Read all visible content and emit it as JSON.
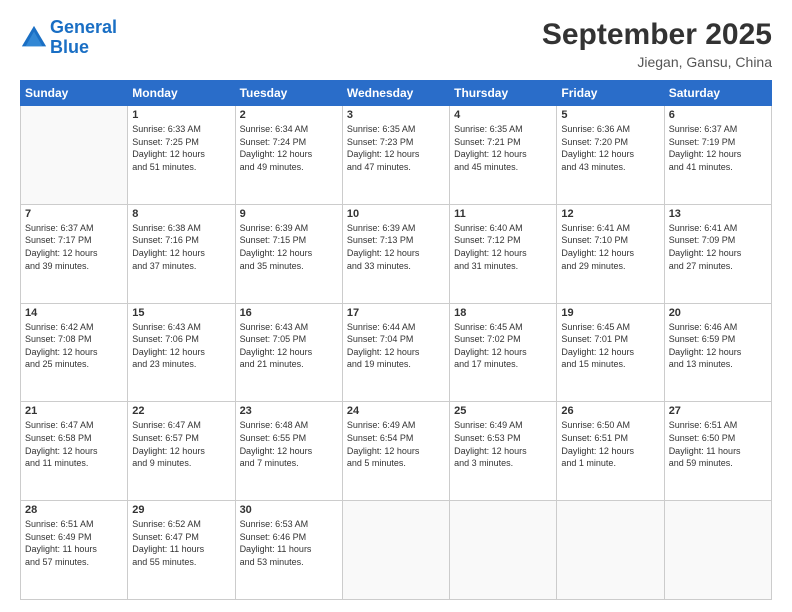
{
  "header": {
    "logo_line1": "General",
    "logo_line2": "Blue",
    "month_year": "September 2025",
    "location": "Jiegan, Gansu, China"
  },
  "days_of_week": [
    "Sunday",
    "Monday",
    "Tuesday",
    "Wednesday",
    "Thursday",
    "Friday",
    "Saturday"
  ],
  "weeks": [
    [
      {
        "day": "",
        "info": ""
      },
      {
        "day": "1",
        "info": "Sunrise: 6:33 AM\nSunset: 7:25 PM\nDaylight: 12 hours\nand 51 minutes."
      },
      {
        "day": "2",
        "info": "Sunrise: 6:34 AM\nSunset: 7:24 PM\nDaylight: 12 hours\nand 49 minutes."
      },
      {
        "day": "3",
        "info": "Sunrise: 6:35 AM\nSunset: 7:23 PM\nDaylight: 12 hours\nand 47 minutes."
      },
      {
        "day": "4",
        "info": "Sunrise: 6:35 AM\nSunset: 7:21 PM\nDaylight: 12 hours\nand 45 minutes."
      },
      {
        "day": "5",
        "info": "Sunrise: 6:36 AM\nSunset: 7:20 PM\nDaylight: 12 hours\nand 43 minutes."
      },
      {
        "day": "6",
        "info": "Sunrise: 6:37 AM\nSunset: 7:19 PM\nDaylight: 12 hours\nand 41 minutes."
      }
    ],
    [
      {
        "day": "7",
        "info": "Sunrise: 6:37 AM\nSunset: 7:17 PM\nDaylight: 12 hours\nand 39 minutes."
      },
      {
        "day": "8",
        "info": "Sunrise: 6:38 AM\nSunset: 7:16 PM\nDaylight: 12 hours\nand 37 minutes."
      },
      {
        "day": "9",
        "info": "Sunrise: 6:39 AM\nSunset: 7:15 PM\nDaylight: 12 hours\nand 35 minutes."
      },
      {
        "day": "10",
        "info": "Sunrise: 6:39 AM\nSunset: 7:13 PM\nDaylight: 12 hours\nand 33 minutes."
      },
      {
        "day": "11",
        "info": "Sunrise: 6:40 AM\nSunset: 7:12 PM\nDaylight: 12 hours\nand 31 minutes."
      },
      {
        "day": "12",
        "info": "Sunrise: 6:41 AM\nSunset: 7:10 PM\nDaylight: 12 hours\nand 29 minutes."
      },
      {
        "day": "13",
        "info": "Sunrise: 6:41 AM\nSunset: 7:09 PM\nDaylight: 12 hours\nand 27 minutes."
      }
    ],
    [
      {
        "day": "14",
        "info": "Sunrise: 6:42 AM\nSunset: 7:08 PM\nDaylight: 12 hours\nand 25 minutes."
      },
      {
        "day": "15",
        "info": "Sunrise: 6:43 AM\nSunset: 7:06 PM\nDaylight: 12 hours\nand 23 minutes."
      },
      {
        "day": "16",
        "info": "Sunrise: 6:43 AM\nSunset: 7:05 PM\nDaylight: 12 hours\nand 21 minutes."
      },
      {
        "day": "17",
        "info": "Sunrise: 6:44 AM\nSunset: 7:04 PM\nDaylight: 12 hours\nand 19 minutes."
      },
      {
        "day": "18",
        "info": "Sunrise: 6:45 AM\nSunset: 7:02 PM\nDaylight: 12 hours\nand 17 minutes."
      },
      {
        "day": "19",
        "info": "Sunrise: 6:45 AM\nSunset: 7:01 PM\nDaylight: 12 hours\nand 15 minutes."
      },
      {
        "day": "20",
        "info": "Sunrise: 6:46 AM\nSunset: 6:59 PM\nDaylight: 12 hours\nand 13 minutes."
      }
    ],
    [
      {
        "day": "21",
        "info": "Sunrise: 6:47 AM\nSunset: 6:58 PM\nDaylight: 12 hours\nand 11 minutes."
      },
      {
        "day": "22",
        "info": "Sunrise: 6:47 AM\nSunset: 6:57 PM\nDaylight: 12 hours\nand 9 minutes."
      },
      {
        "day": "23",
        "info": "Sunrise: 6:48 AM\nSunset: 6:55 PM\nDaylight: 12 hours\nand 7 minutes."
      },
      {
        "day": "24",
        "info": "Sunrise: 6:49 AM\nSunset: 6:54 PM\nDaylight: 12 hours\nand 5 minutes."
      },
      {
        "day": "25",
        "info": "Sunrise: 6:49 AM\nSunset: 6:53 PM\nDaylight: 12 hours\nand 3 minutes."
      },
      {
        "day": "26",
        "info": "Sunrise: 6:50 AM\nSunset: 6:51 PM\nDaylight: 12 hours\nand 1 minute."
      },
      {
        "day": "27",
        "info": "Sunrise: 6:51 AM\nSunset: 6:50 PM\nDaylight: 11 hours\nand 59 minutes."
      }
    ],
    [
      {
        "day": "28",
        "info": "Sunrise: 6:51 AM\nSunset: 6:49 PM\nDaylight: 11 hours\nand 57 minutes."
      },
      {
        "day": "29",
        "info": "Sunrise: 6:52 AM\nSunset: 6:47 PM\nDaylight: 11 hours\nand 55 minutes."
      },
      {
        "day": "30",
        "info": "Sunrise: 6:53 AM\nSunset: 6:46 PM\nDaylight: 11 hours\nand 53 minutes."
      },
      {
        "day": "",
        "info": ""
      },
      {
        "day": "",
        "info": ""
      },
      {
        "day": "",
        "info": ""
      },
      {
        "day": "",
        "info": ""
      }
    ]
  ]
}
